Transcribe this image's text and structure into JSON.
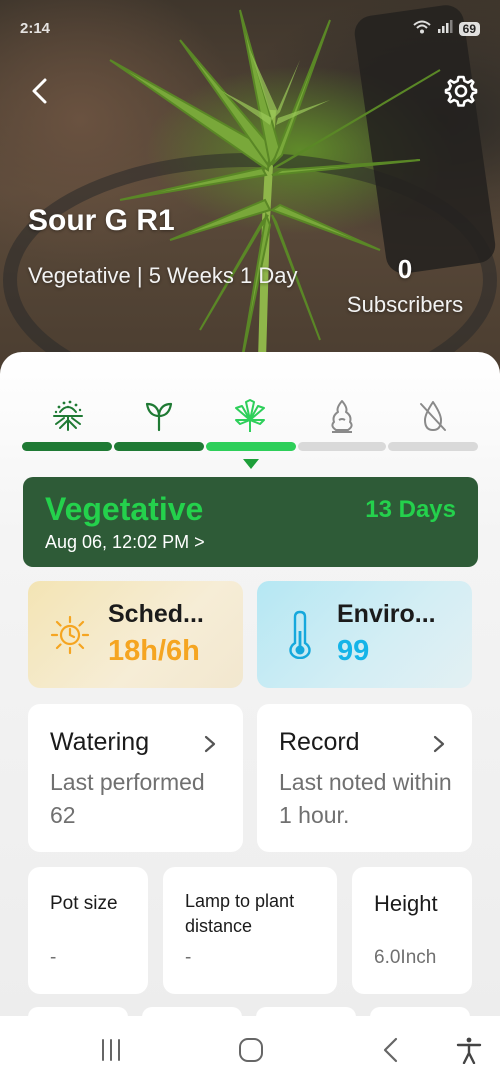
{
  "status_bar": {
    "time": "2:14",
    "battery": "69"
  },
  "header": {
    "plant_name": "Sour G R1",
    "stage_info": "Vegetative | 5 Weeks 1 Day",
    "subscriber_count": "0",
    "subscriber_label": "Subscribers"
  },
  "stage_tracker": {
    "stages": [
      {
        "icon": "germination-icon",
        "state": "complete"
      },
      {
        "icon": "seedling-icon",
        "state": "complete"
      },
      {
        "icon": "vegetative-leaf-icon",
        "state": "current"
      },
      {
        "icon": "flowering-bud-icon",
        "state": "upcoming"
      },
      {
        "icon": "harvest-drying-icon",
        "state": "upcoming"
      }
    ],
    "colors": {
      "complete": "#1f7a34",
      "current": "#2ecf5a",
      "upcoming": "#d9d9d9"
    }
  },
  "current_stage": {
    "title": "Vegetative",
    "days": "13 Days",
    "started": "Aug 06, 12:02 PM >"
  },
  "schedule": {
    "title": "Sched...",
    "value": "18h/6h",
    "icon": "sun-icon",
    "color": "#f5a521"
  },
  "environment": {
    "title": "Enviro...",
    "value": "99",
    "icon": "thermometer-icon",
    "color": "#15b4e8"
  },
  "watering": {
    "title": "Watering",
    "subtitle": "Last performed 62"
  },
  "record": {
    "title": "Record",
    "subtitle": "Last noted within 1 hour."
  },
  "stats": {
    "pot_size": {
      "label": "Pot size",
      "value": "-"
    },
    "lamp_distance": {
      "label": "Lamp to plant distance",
      "value": "-"
    },
    "height": {
      "label": "Height",
      "value": "6.0Inch"
    }
  }
}
